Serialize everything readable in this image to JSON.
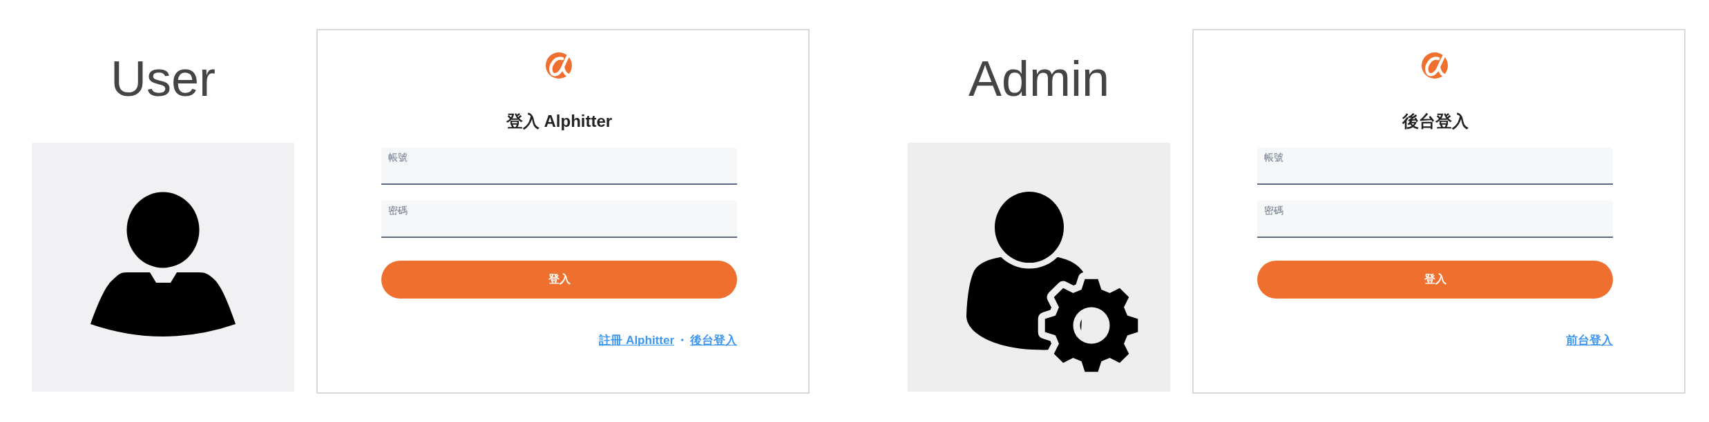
{
  "sections": [
    {
      "kind": "user",
      "heading": "User",
      "login": {
        "title": "登入 Alphitter",
        "fields": [
          {
            "label": "帳號"
          },
          {
            "label": "密碼"
          }
        ],
        "submit": "登入",
        "links": [
          "註冊 Alphitter",
          "後台登入"
        ],
        "separator": "・"
      }
    },
    {
      "kind": "admin",
      "heading": "Admin",
      "login": {
        "title": "後台登入",
        "fields": [
          {
            "label": "帳號"
          },
          {
            "label": "密碼"
          }
        ],
        "submit": "登入",
        "links": [
          "前台登入"
        ]
      }
    }
  ]
}
